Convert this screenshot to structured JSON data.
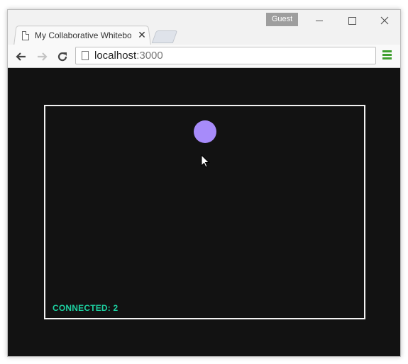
{
  "window": {
    "profile_badge": "Guest",
    "controls": {
      "minimize_icon": "minimize-icon",
      "maximize_icon": "maximize-icon",
      "close_icon": "close-icon"
    }
  },
  "tabs": [
    {
      "title": "My Collaborative Whitebo",
      "icon": "page-icon",
      "close_glyph": "✕"
    }
  ],
  "toolbar": {
    "back_glyph": "←",
    "forward_glyph": "→",
    "reload_glyph": "⟳",
    "address": {
      "host": "localhost",
      "port": ":3000"
    },
    "menu_icon": "hamburger-menu-icon"
  },
  "whiteboard": {
    "status_text": "CONNECTED: 2",
    "colors": {
      "background": "#121212",
      "border": "#f2f2f2",
      "peer_dot": "#a78bfa",
      "status": "#1dd1a1"
    }
  }
}
